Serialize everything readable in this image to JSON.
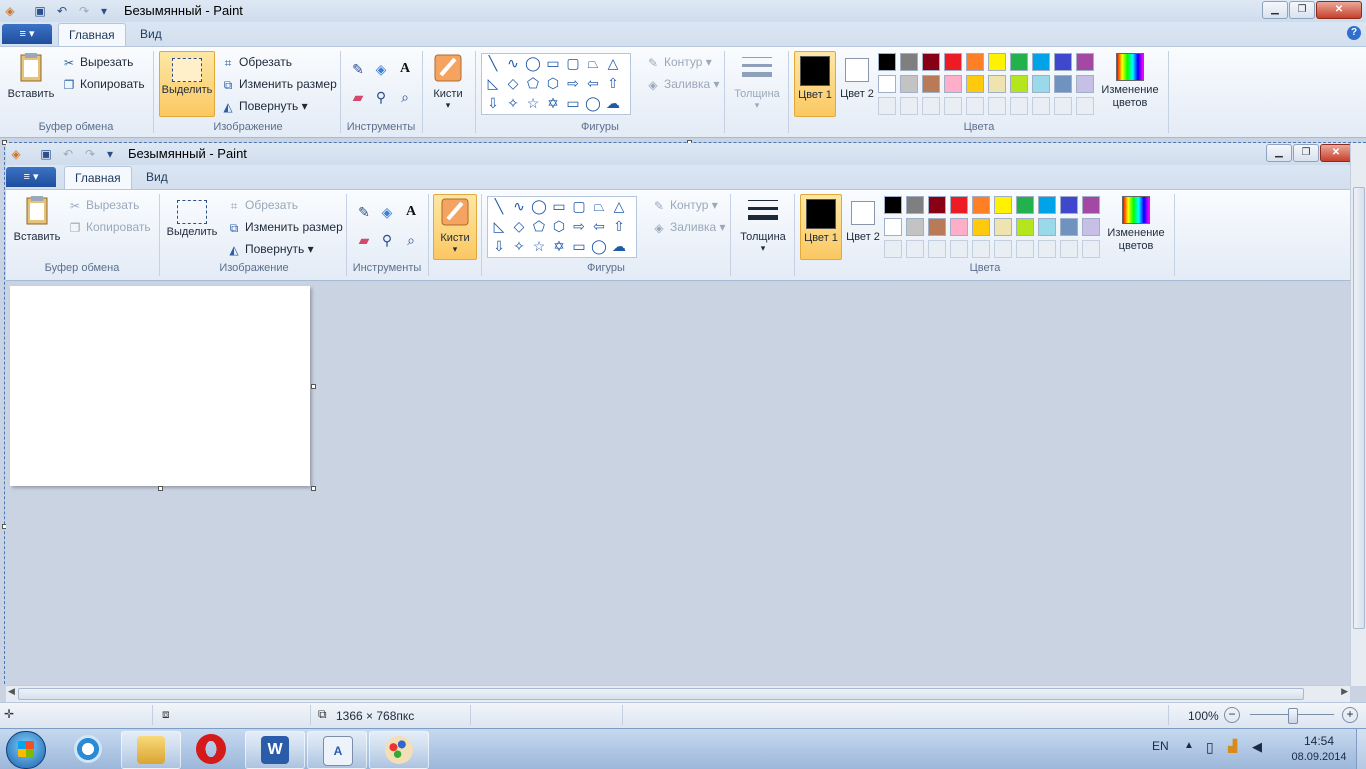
{
  "window_title": "Безымянный - Paint",
  "tabs": {
    "file": "≡ ▾",
    "home": "Главная",
    "view": "Вид"
  },
  "help_glyph": "?",
  "clipboard": {
    "paste": "Вставить",
    "cut": "Вырезать",
    "copy": "Копировать",
    "label": "Буфер обмена"
  },
  "image": {
    "select": "Выделить",
    "crop": "Обрезать",
    "resize": "Изменить размер",
    "rotate": "Повернуть",
    "label": "Изображение"
  },
  "tools": {
    "label": "Инструменты"
  },
  "brushes": {
    "label": "Кисти"
  },
  "shapes": {
    "label": "Фигуры",
    "outline": "Контур",
    "fill": "Заливка"
  },
  "size": {
    "label": "Толщина"
  },
  "colors": {
    "color1": "Цвет 1",
    "color2": "Цвет 2",
    "edit": "Изменение цветов",
    "label": "Цвета",
    "palette": [
      "#000000",
      "#7f7f7f",
      "#880015",
      "#ed1c24",
      "#ff7f27",
      "#fff200",
      "#22b14c",
      "#00a2e8",
      "#3f48cc",
      "#a349a4",
      "#ffffff",
      "#c3c3c3",
      "#b97a57",
      "#ffaec9",
      "#ffc90e",
      "#efe4b0",
      "#b5e61d",
      "#99d9ea",
      "#7092be",
      "#c8bfe7"
    ]
  },
  "status": {
    "dimensions": "1366 × 768пкс",
    "zoom": "100%"
  },
  "tray": {
    "lang": "EN",
    "time": "14:54",
    "date": "08.09.2014"
  }
}
